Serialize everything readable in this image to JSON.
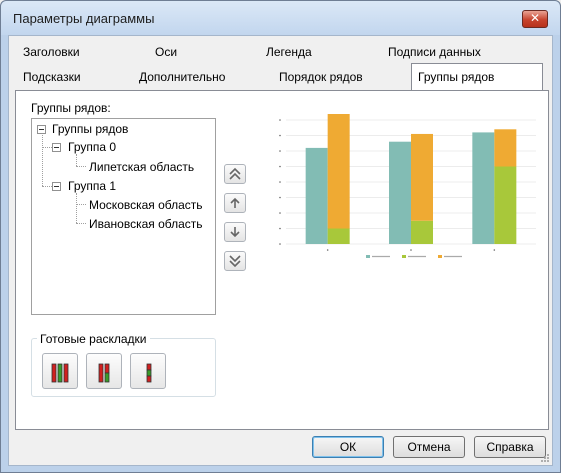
{
  "window": {
    "title": "Параметры диаграммы",
    "close_glyph": "✕"
  },
  "tabs": {
    "row1": [
      "Заголовки",
      "Оси",
      "Легенда",
      "Подписи данных"
    ],
    "row2": [
      "Подсказки",
      "Дополнительно",
      "Порядок рядов",
      "Группы рядов"
    ],
    "active": "Группы рядов"
  },
  "series_groups": {
    "label": "Группы рядов:",
    "tree": {
      "root": "Группы рядов",
      "groups": [
        {
          "name": "Группа 0",
          "items": [
            "Липетская область"
          ]
        },
        {
          "name": "Группа 1",
          "items": [
            "Московская область",
            "Ивановская область"
          ]
        }
      ]
    },
    "side_buttons": [
      "move-top-icon",
      "move-up-icon",
      "move-down-icon",
      "move-bottom-icon"
    ]
  },
  "presets": {
    "title": "Готовые раскладки",
    "buttons": [
      "layout-three-columns-icon",
      "layout-two-columns-icon",
      "layout-single-column-icon"
    ]
  },
  "chart_data": {
    "type": "bar",
    "stacked": true,
    "categories": [
      "",
      "",
      ""
    ],
    "series": [
      {
        "name": "",
        "group": 0,
        "color": "#82bcb4",
        "values": [
          62,
          66,
          72
        ]
      },
      {
        "name": "",
        "group": 1,
        "color": "#a8c83a",
        "values": [
          10,
          15,
          50
        ]
      },
      {
        "name": "",
        "group": 1,
        "color": "#efaa33",
        "values": [
          76,
          56,
          24
        ]
      }
    ],
    "ylim": [
      0,
      80
    ],
    "grid": true,
    "legend_position": "bottom"
  },
  "buttons": {
    "ok": "ОК",
    "cancel": "Отмена",
    "help": "Справка"
  },
  "colors": {
    "accent_red": "#d02020",
    "accent_green": "#3a9a2a",
    "tab_border": "#898c95"
  }
}
